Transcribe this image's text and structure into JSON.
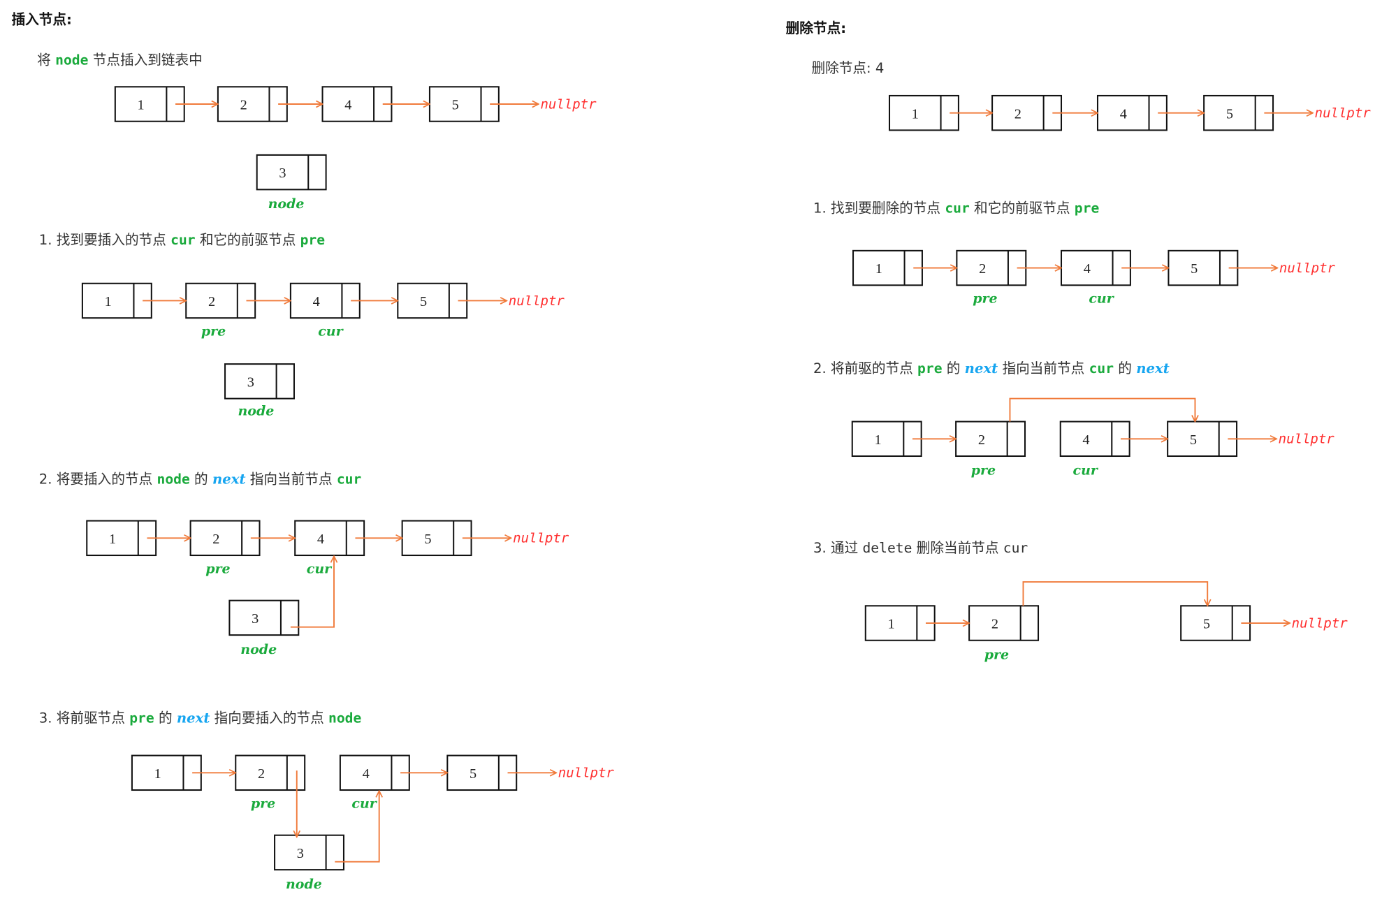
{
  "colors": {
    "text": "#333333",
    "code": "#1aaa3c",
    "emph": "#16a5f0",
    "arrow": "#f07a3a",
    "nullptr": "#ff3030",
    "box": "#111111"
  },
  "insert": {
    "title": "插入节点:",
    "lines": [
      [
        {
          "t": "将 ",
          "c": "plain"
        },
        {
          "t": "node",
          "c": "code"
        },
        {
          "t": " 节点插入到链表中",
          "c": "plain"
        }
      ],
      [
        {
          "t": "1.  找到要插入的节点 ",
          "c": "plain"
        },
        {
          "t": "cur",
          "c": "code"
        },
        {
          "t": " 和它的前驱节点 ",
          "c": "plain"
        },
        {
          "t": "pre",
          "c": "code"
        }
      ],
      [
        {
          "t": "2.  将要插入的节点 ",
          "c": "plain"
        },
        {
          "t": "node",
          "c": "code"
        },
        {
          "t": " 的 ",
          "c": "plain"
        },
        {
          "t": "next",
          "c": "emph"
        },
        {
          "t": " 指向当前节点 ",
          "c": "plain"
        },
        {
          "t": "cur",
          "c": "code"
        }
      ],
      [
        {
          "t": "3.  将前驱节点 ",
          "c": "plain"
        },
        {
          "t": "pre",
          "c": "code"
        },
        {
          "t": " 的 ",
          "c": "plain"
        },
        {
          "t": "next",
          "c": "emph"
        },
        {
          "t": " 指向要插入的节点 ",
          "c": "plain"
        },
        {
          "t": "node",
          "c": "code"
        }
      ]
    ],
    "diagrams": [
      {
        "nodes": [
          "1",
          "2",
          "4",
          "5",
          "3"
        ],
        "null": "nullptr",
        "labels": [
          "node"
        ]
      },
      {
        "nodes": [
          "1",
          "2",
          "4",
          "5",
          "3"
        ],
        "null": "nullptr",
        "labels": [
          "pre",
          "cur",
          "node"
        ]
      },
      {
        "nodes": [
          "1",
          "2",
          "4",
          "5",
          "3"
        ],
        "null": "nullptr",
        "labels": [
          "pre",
          "cur",
          "node"
        ]
      },
      {
        "nodes": [
          "1",
          "2",
          "4",
          "5",
          "3"
        ],
        "null": "nullptr",
        "labels": [
          "pre",
          "cur",
          "node"
        ]
      }
    ]
  },
  "delete": {
    "title": "删除节点:",
    "lines": [
      [
        {
          "t": "删除节点: 4",
          "c": "plain"
        }
      ],
      [
        {
          "t": "1.  找到要删除的节点 ",
          "c": "plain"
        },
        {
          "t": "cur",
          "c": "code"
        },
        {
          "t": " 和它的前驱节点 ",
          "c": "plain"
        },
        {
          "t": "pre",
          "c": "code"
        }
      ],
      [
        {
          "t": "2.  将前驱的节点 ",
          "c": "plain"
        },
        {
          "t": "pre",
          "c": "code"
        },
        {
          "t": " 的 ",
          "c": "plain"
        },
        {
          "t": "next",
          "c": "emph"
        },
        {
          "t": " 指向当前节点 ",
          "c": "plain"
        },
        {
          "t": "cur",
          "c": "code"
        },
        {
          "t": " 的 ",
          "c": "plain"
        },
        {
          "t": "next",
          "c": "emph"
        }
      ],
      [
        {
          "t": "3.  通过 ",
          "c": "plain"
        },
        {
          "t": "delete",
          "c": "mono"
        },
        {
          "t": " 删除当前节点 ",
          "c": "plain"
        },
        {
          "t": "cur",
          "c": "mono"
        }
      ]
    ],
    "diagrams": [
      {
        "nodes": [
          "1",
          "2",
          "4",
          "5"
        ],
        "null": "nullptr",
        "labels": []
      },
      {
        "nodes": [
          "1",
          "2",
          "4",
          "5"
        ],
        "null": "nullptr",
        "labels": [
          "pre",
          "cur"
        ]
      },
      {
        "nodes": [
          "1",
          "2",
          "4",
          "5"
        ],
        "null": "nullptr",
        "labels": [
          "pre",
          "cur"
        ]
      },
      {
        "nodes": [
          "1",
          "2",
          "5"
        ],
        "null": "nullptr",
        "labels": [
          "pre"
        ]
      }
    ]
  }
}
